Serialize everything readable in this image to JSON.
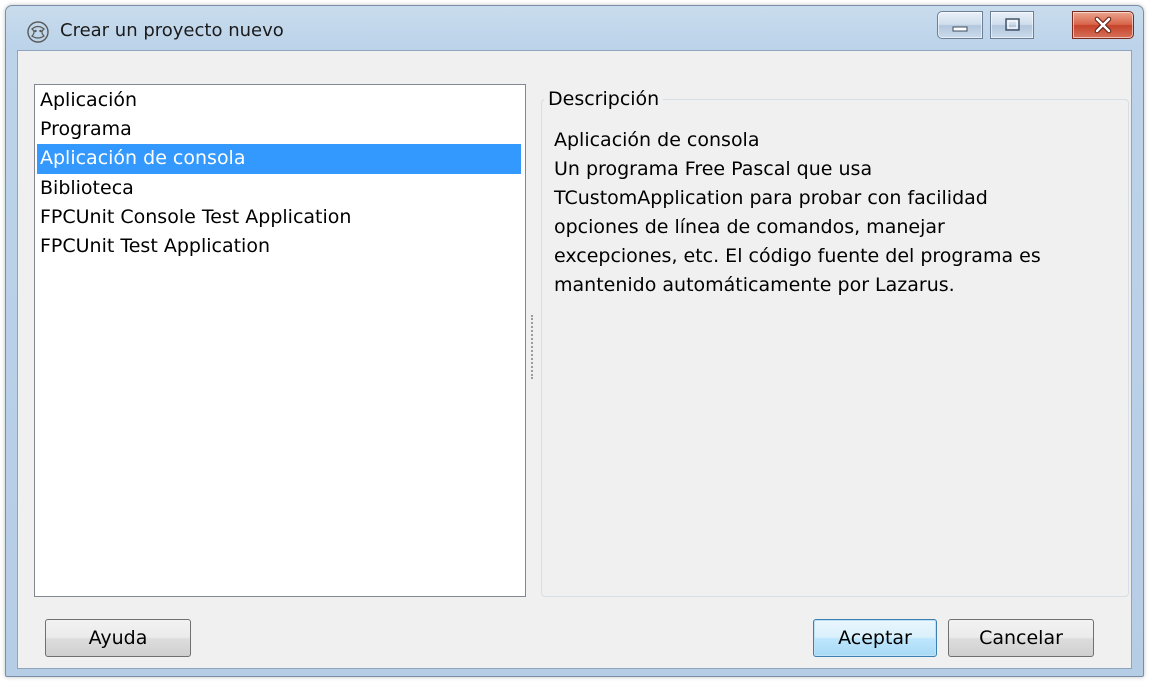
{
  "window": {
    "title": "Crear un proyecto nuevo"
  },
  "project_types": {
    "items": [
      {
        "label": "Aplicación",
        "selected": false
      },
      {
        "label": "Programa",
        "selected": false
      },
      {
        "label": "Aplicación de consola",
        "selected": true
      },
      {
        "label": "Biblioteca",
        "selected": false
      },
      {
        "label": "FPCUnit Console Test Application",
        "selected": false
      },
      {
        "label": "FPCUnit Test Application",
        "selected": false
      }
    ]
  },
  "description": {
    "legend": "Descripción",
    "lines": [
      "Aplicación de consola",
      "Un programa Free Pascal que usa",
      "TCustomApplication para probar con facilidad",
      "opciones de línea de comandos, manejar",
      "excepciones, etc. El código fuente del programa es",
      "mantenido automáticamente por Lazarus."
    ]
  },
  "buttons": {
    "help": "Ayuda",
    "ok": "Aceptar",
    "cancel": "Cancelar"
  },
  "colors": {
    "selection": "#3399ff",
    "close_button": "#c6432a"
  },
  "icons": {
    "app": "lazarus-icon",
    "minimize": "minimize-icon",
    "maximize": "maximize-icon",
    "close": "close-icon"
  }
}
